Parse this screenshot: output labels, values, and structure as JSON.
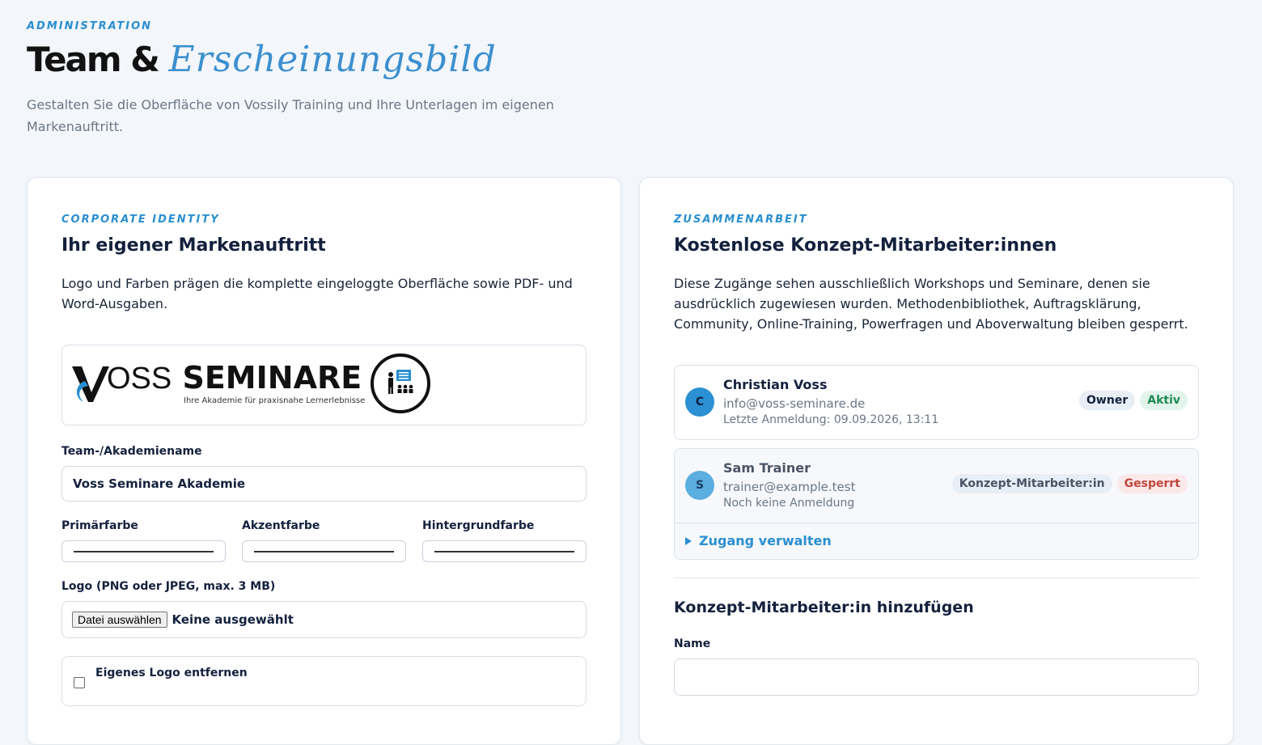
{
  "header": {
    "eyebrow": "ADMINISTRATION",
    "title_bold": "Team &",
    "title_script": "Erscheinungsbild",
    "subtitle": "Gestalten Sie die Oberfläche von Vossily Training und Ihre Unterlagen im eigenen Markenauftritt."
  },
  "branding": {
    "eyebrow": "CORPORATE IDENTITY",
    "title": "Ihr eigener Markenauftritt",
    "description": "Logo und Farben prägen die komplette eingeloggte Oberfläche sowie PDF- und Word-Ausgaben.",
    "logo": {
      "text_voss": "OSS",
      "text_seminare": "SEMINARE",
      "tagline": "Ihre Akademie für praxisnahe Lernerlebnisse"
    },
    "team_name_label": "Team-/Akademiename",
    "team_name_value": "Voss Seminare Akademie",
    "primary_color_label": "Primärfarbe",
    "accent_color_label": "Akzentfarbe",
    "background_color_label": "Hintergrundfarbe",
    "logo_upload_label": "Logo (PNG oder JPEG, max. 3 MB)",
    "file_button": "Datei auswählen",
    "file_status": "Keine ausgewählt",
    "remove_logo_label": "Eigenes Logo entfernen"
  },
  "collaboration": {
    "eyebrow": "ZUSAMMENARBEIT",
    "title": "Kostenlose Konzept-Mitarbeiter:innen",
    "description": "Diese Zugänge sehen ausschließlich Workshops und Seminare, denen sie ausdrücklich zugewiesen wurden. Methodenbibliothek, Auftragsklärung, Community, Online-Training, Powerfragen und Aboverwaltung bleiben gesperrt.",
    "members": [
      {
        "initial": "C",
        "name": "Christian Voss",
        "email": "info@voss-seminare.de",
        "last_login": "Letzte Anmeldung: 09.09.2026, 13:11",
        "role": "Owner",
        "status": "Aktiv"
      },
      {
        "initial": "S",
        "name": "Sam Trainer",
        "email": "trainer@example.test",
        "last_login": "Noch keine Anmeldung",
        "role": "Konzept-Mitarbeiter:in",
        "status": "Gesperrt",
        "manage_label": "Zugang verwalten"
      }
    ],
    "add_title": "Konzept-Mitarbeiter:in hinzufügen",
    "name_label": "Name",
    "name_value": ""
  }
}
